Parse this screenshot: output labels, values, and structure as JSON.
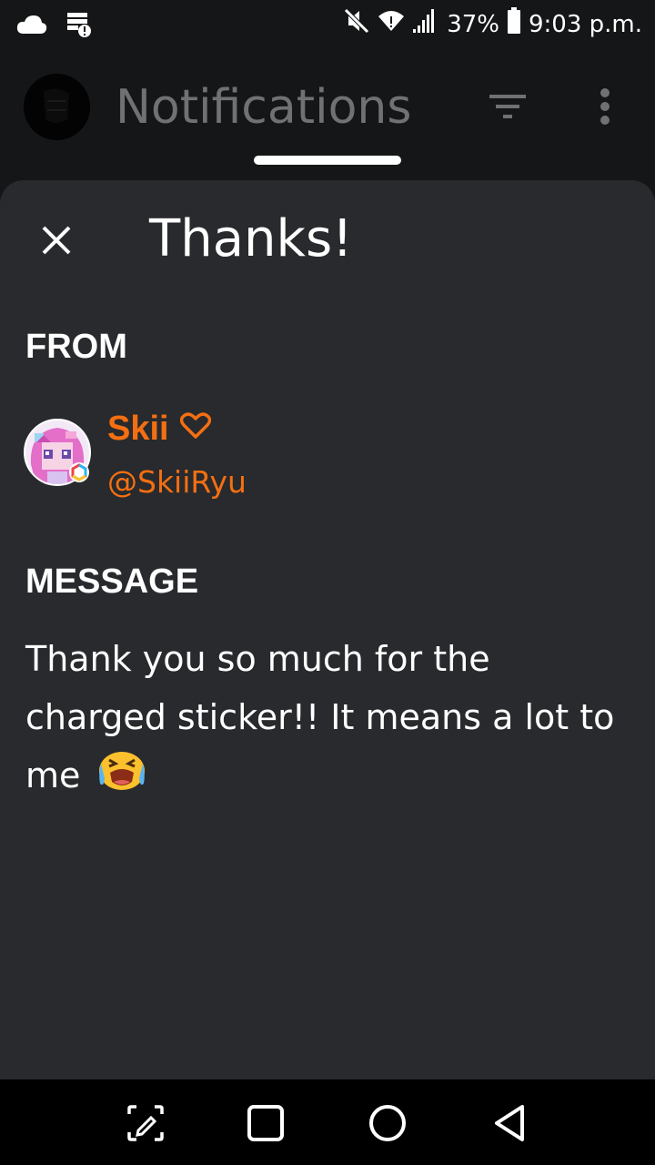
{
  "status_bar": {
    "battery_percent": "37%",
    "time": "9:03 p.m.",
    "icons": [
      "cloud-icon",
      "sim-alert-icon",
      "mute-icon",
      "wifi-icon",
      "signal-icon",
      "battery-icon"
    ]
  },
  "header": {
    "title": "Notifications",
    "icons": [
      "avatar",
      "filter-icon",
      "more-vert-icon"
    ]
  },
  "sheet": {
    "title": "Thanks!",
    "close_icon": "close-icon",
    "from_label": "FROM",
    "sender": {
      "name": "Skii",
      "name_icon": "heart-outline-icon",
      "handle": "@SkiiRyu",
      "color": "#f46f12"
    },
    "message_label": "MESSAGE",
    "message_text": "Thank you so much for the charged sticker!! It means a lot to me",
    "message_emoji": "crying-face-emoji"
  },
  "nav_bar": {
    "icons": [
      "screenshot-edit-icon",
      "recents-icon",
      "home-icon",
      "back-icon"
    ]
  },
  "colors": {
    "background": "#151617",
    "sheet": "#282a2d",
    "accent": "#f46f12",
    "header_title": "#6f7173"
  }
}
